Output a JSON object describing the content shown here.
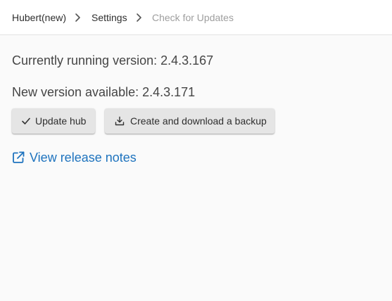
{
  "breadcrumb": {
    "items": [
      {
        "label": "Hubert(new)"
      },
      {
        "label": "Settings"
      },
      {
        "label": "Check for Updates"
      }
    ]
  },
  "versions": {
    "current_label": "Currently running version: 2.4.3.167",
    "new_label": "New version available: 2.4.3.171"
  },
  "actions": {
    "update_label": "Update hub",
    "backup_label": "Create and download a backup",
    "release_notes_label": "View release notes"
  },
  "colors": {
    "link": "#1e73be",
    "button_bg": "#e5e5e5",
    "breadcrumb_current": "#9e9e9e",
    "page_bg": "#fafafa"
  },
  "icons": {
    "separator": "chevron-right-icon",
    "update": "check-icon",
    "backup": "download-tray-icon",
    "release_notes": "external-link-icon"
  }
}
